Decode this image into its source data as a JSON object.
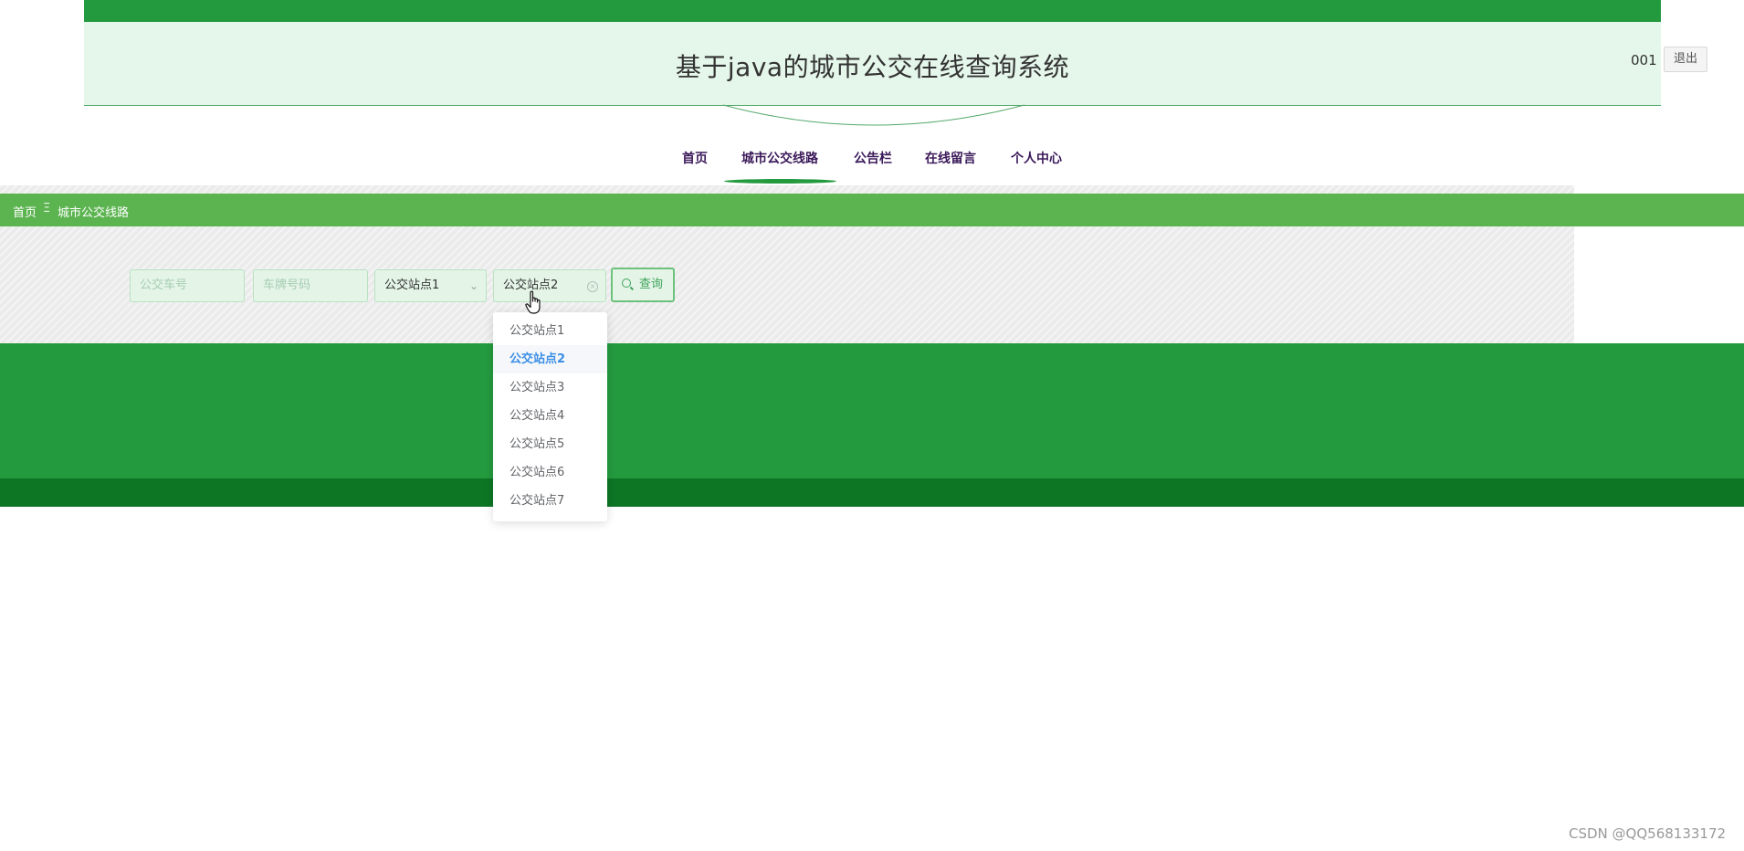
{
  "header": {
    "title": "基于java的城市公交在线查询系统",
    "user": "001",
    "logout_label": "退出"
  },
  "nav": {
    "items": [
      {
        "label": "首页"
      },
      {
        "label": "城市公交线路",
        "active": true
      },
      {
        "label": "公告栏"
      },
      {
        "label": "在线留言"
      },
      {
        "label": "个人中心"
      }
    ]
  },
  "breadcrumb": {
    "items": [
      "首页",
      "城市公交线路"
    ],
    "separator": "Ξ"
  },
  "search_form": {
    "bus_number_placeholder": "公交车号",
    "plate_number_placeholder": "车牌号码",
    "station1_value": "公交站点1",
    "station2_value": "公交站点2",
    "search_label": "查询"
  },
  "dropdown": {
    "options": [
      "公交站点1",
      "公交站点2",
      "公交站点3",
      "公交站点4",
      "公交站点5",
      "公交站点6",
      "公交站点7"
    ],
    "selected": "公交站点2"
  },
  "colors": {
    "primary_green": "#249a3f",
    "breadcrumb_green": "#5cb450",
    "footer_dark_green": "#0d7625",
    "selected_blue": "#3a8ee6"
  },
  "watermark": "CSDN @QQ568133172"
}
